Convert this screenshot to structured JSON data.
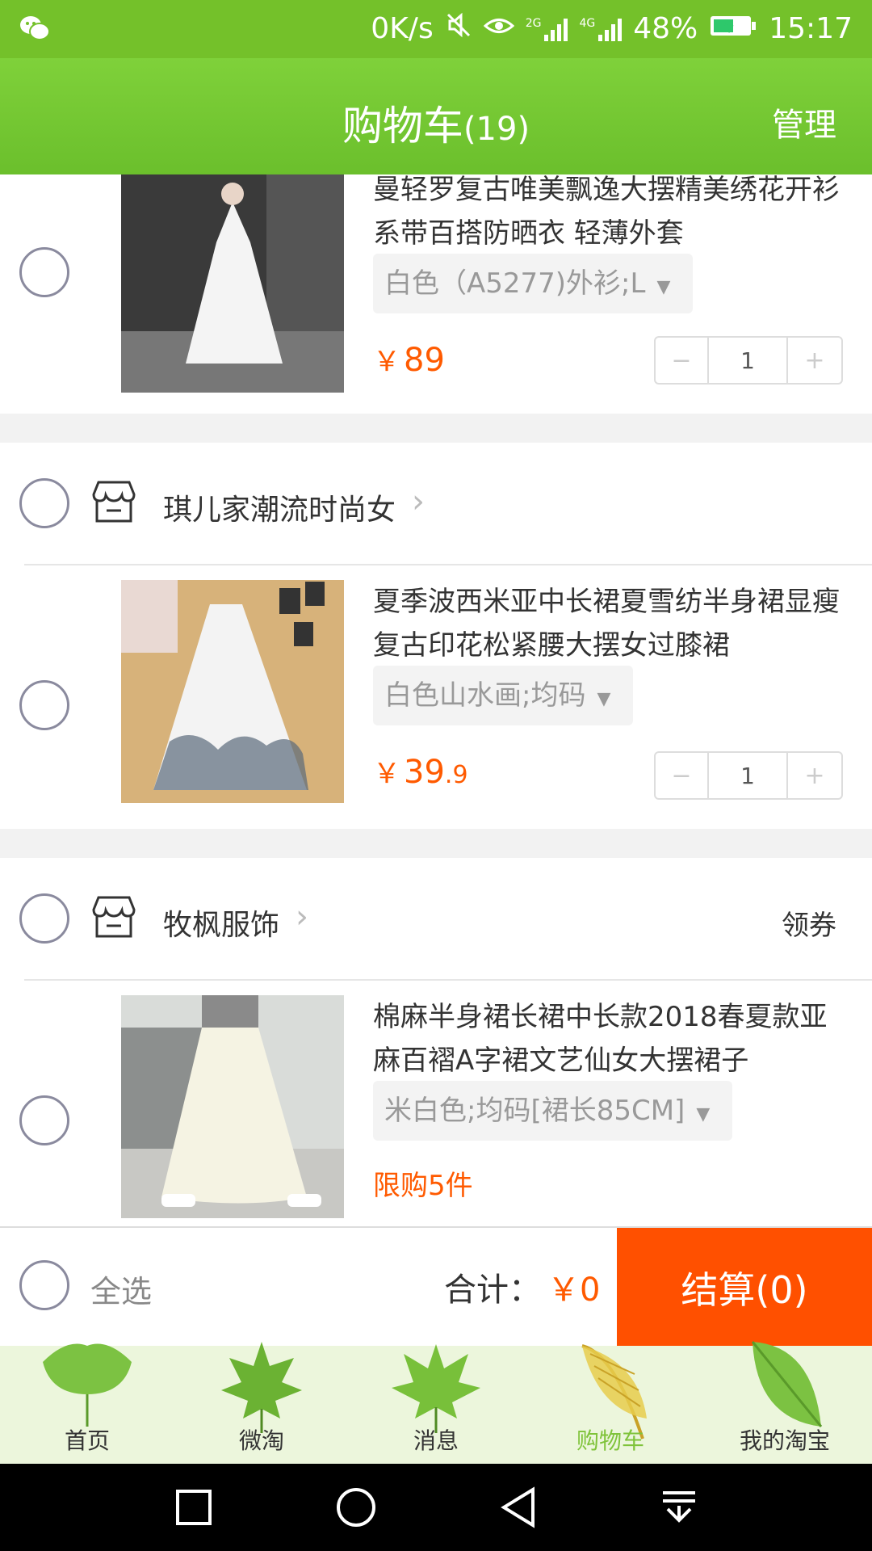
{
  "status_bar": {
    "speed": "0K/s",
    "battery": "48%",
    "time": "15:17",
    "net1": "2G",
    "net2": "4G"
  },
  "header": {
    "title": "购物车",
    "count": "(19)",
    "manage": "管理"
  },
  "shops": [
    {
      "name": "琪儿家潮流时尚女"
    },
    {
      "name": "牧枫服饰",
      "coupon": "领券"
    }
  ],
  "items": [
    {
      "title": "曼轻罗复古唯美飘逸大摆精美绣花开衫系带百搭防晒衣 轻薄外套",
      "sku": "白色（A5277)外衫;L",
      "price_int": "89",
      "price_dec": "",
      "qty": "1"
    },
    {
      "title": "夏季波西米亚中长裙夏雪纺半身裙显瘦复古印花松紧腰大摆女过膝裙",
      "sku": "白色山水画;均码",
      "price_int": "39",
      "price_dec": ".9",
      "qty": "1"
    },
    {
      "title": "棉麻半身裙长裙中长款2018春夏款亚麻百褶A字裙文艺仙女大摆裙子",
      "sku": "米白色;均码[裙长85CM]",
      "limit": "限购5件"
    }
  ],
  "currency": "￥",
  "stepper": {
    "minus": "−",
    "plus": "+"
  },
  "footer": {
    "select_all": "全选",
    "total_label": "合计：",
    "total_amount": "￥0",
    "checkout": "结算(0)"
  },
  "tabs": [
    {
      "label": "首页"
    },
    {
      "label": "微淘"
    },
    {
      "label": "消息"
    },
    {
      "label": "购物车"
    },
    {
      "label": "我的淘宝"
    }
  ],
  "colors": {
    "header": "#74c12a",
    "accent": "#ff5000",
    "price": "#ff5a00",
    "active_tab": "#7fc33a"
  }
}
